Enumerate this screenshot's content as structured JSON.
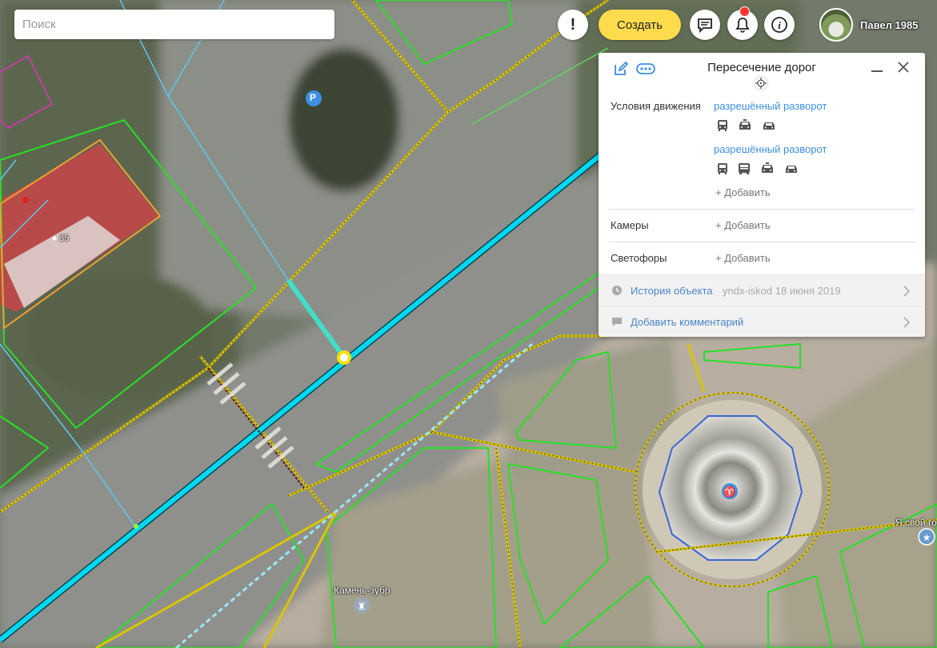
{
  "search": {
    "placeholder": "Поиск"
  },
  "toolbar": {
    "create_label": "Создать",
    "alert_label": "!"
  },
  "user": {
    "name": "Павел 1985"
  },
  "colors": {
    "accent": "#ffdb4d",
    "link": "#3d8fe0",
    "road": "#00d8f0",
    "parcel": "#26e026",
    "path": "#d8c400",
    "fountain": "#3a66d8"
  },
  "panel": {
    "title": "Пересечение дорог",
    "traffic": {
      "label": "Условия движения",
      "rules": [
        {
          "link": "разрешённый разворот",
          "vehicles": [
            "bus-icon",
            "taxi-icon",
            "car-icon"
          ]
        },
        {
          "link": "разрешённый разворот",
          "vehicles": [
            "bus-icon",
            "truck-icon",
            "taxi-icon",
            "car-icon"
          ]
        }
      ],
      "add_label": "+ Добавить"
    },
    "cameras": {
      "label": "Камеры",
      "add_label": "+ Добавить"
    },
    "lights": {
      "label": "Светофоры",
      "add_label": "+ Добавить"
    },
    "history": {
      "label": "История объекта",
      "author": "yndx-iskod",
      "date": "18 июня 2019"
    },
    "comment": {
      "label": "Добавить комментарий"
    }
  },
  "map": {
    "labels": {
      "house_number": "35",
      "monument": "Камень-зубр",
      "place": "Я свой го",
      "parking": "P"
    }
  }
}
